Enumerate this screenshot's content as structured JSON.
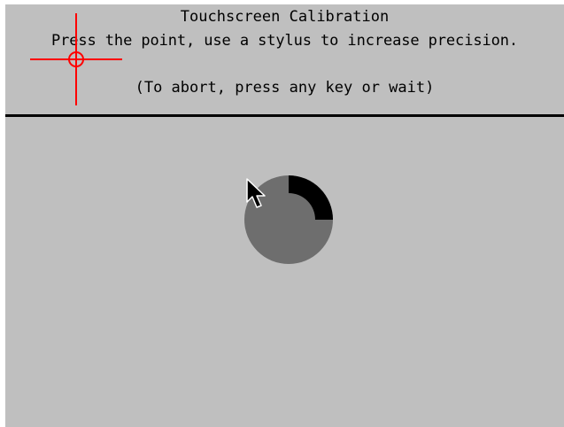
{
  "calibration": {
    "title": "Touchscreen Calibration",
    "instruction": "Press the point, use a stylus to increase precision.",
    "abort_hint": "(To abort, press any key or wait)"
  },
  "colors": {
    "background": "#bfbfbf",
    "text": "#000000",
    "separator": "#000000",
    "crosshair": "#ff0000",
    "timeout_circle": "#6e6e6e",
    "timeout_arc": "#000000"
  },
  "icons": {
    "target": "crosshair-icon",
    "timeout": "timeout-progress-icon",
    "pointer": "mouse-cursor-icon"
  },
  "timeout": {
    "elapsed_fraction": 0.25
  }
}
